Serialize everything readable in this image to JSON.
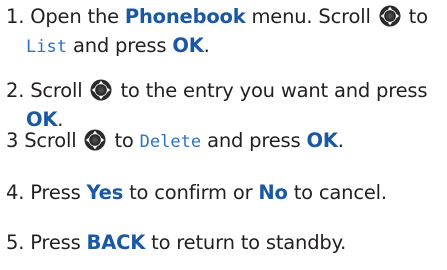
{
  "steps": [
    {
      "num": "1.",
      "parts": [
        {
          "t": "text",
          "v": "Open the "
        },
        {
          "t": "kw",
          "v": "Phonebook"
        },
        {
          "t": "text",
          "v": " menu. Scroll "
        },
        {
          "t": "icon",
          "v": "nav-key-icon"
        },
        {
          "t": "text",
          "v": " to"
        }
      ],
      "line2": [
        {
          "t": "lcd",
          "v": "List"
        },
        {
          "t": "text",
          "v": " and press "
        },
        {
          "t": "kw",
          "v": "OK"
        },
        {
          "t": "text",
          "v": "."
        }
      ]
    },
    {
      "num": "2.",
      "parts": [
        {
          "t": "text",
          "v": "Scroll "
        },
        {
          "t": "icon",
          "v": "nav-key-icon"
        },
        {
          "t": "text",
          "v": " to the entry you want and press"
        }
      ],
      "line2": [
        {
          "t": "kw",
          "v": "OK"
        },
        {
          "t": "text",
          "v": "."
        }
      ]
    },
    {
      "num": "3",
      "parts": [
        {
          "t": "text",
          "v": "Scroll "
        },
        {
          "t": "icon",
          "v": "nav-key-icon"
        },
        {
          "t": "text",
          "v": " to "
        },
        {
          "t": "lcd",
          "v": "Delete"
        },
        {
          "t": "text",
          "v": " and press "
        },
        {
          "t": "kw",
          "v": "OK"
        },
        {
          "t": "text",
          "v": "."
        }
      ]
    },
    {
      "num": "4.",
      "parts": [
        {
          "t": "text",
          "v": "Press "
        },
        {
          "t": "kw",
          "v": "Yes"
        },
        {
          "t": "text",
          "v": " to confirm or "
        },
        {
          "t": "kw",
          "v": "No"
        },
        {
          "t": "text",
          "v": " to cancel."
        }
      ]
    },
    {
      "num": "5.",
      "parts": [
        {
          "t": "text",
          "v": "Press "
        },
        {
          "t": "kw",
          "v": "BACK"
        },
        {
          "t": "text",
          "v": " to return to standby."
        }
      ]
    }
  ],
  "colors": {
    "keyword": "#1a57a5",
    "lcd_text": "#2e73c4",
    "body_text": "#231f20"
  }
}
